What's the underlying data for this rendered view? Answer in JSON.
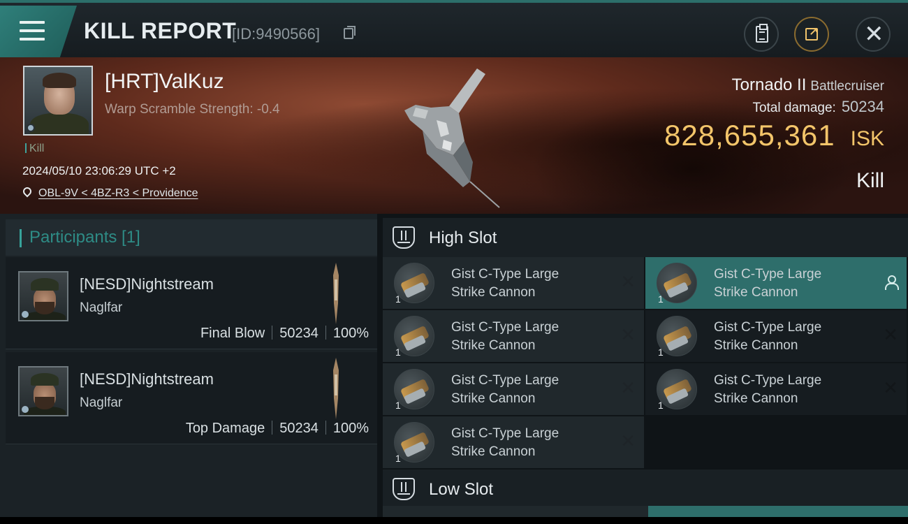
{
  "header": {
    "title": "KILL REPORT",
    "report_id": "[ID:9490566]",
    "icons": [
      "menu-icon",
      "copy-icon",
      "clipboard-icon",
      "share-icon",
      "close-icon"
    ]
  },
  "victim": {
    "name": "[HRT]ValKuz",
    "scramble": "Warp Scramble Strength: -0.4",
    "role": "Kill",
    "datetime": "2024/05/10 23:06:29 UTC +2",
    "location": "OBL-9V < 4BZ-R3 < Providence",
    "ship_name": "Tornado II",
    "ship_class": "Battlecruiser",
    "total_damage_label": "Total damage:",
    "total_damage": "50234",
    "isk_value": "828,655,361",
    "isk_unit": "ISK",
    "result": "Kill"
  },
  "participants": {
    "title": "Participants [1]",
    "rows": [
      {
        "name": "[NESD]Nightstream",
        "ship": "Naglfar",
        "tag": "Final Blow",
        "damage": "50234",
        "percent": "100%"
      },
      {
        "name": "[NESD]Nightstream",
        "ship": "Naglfar",
        "tag": "Top Damage",
        "damage": "50234",
        "percent": "100%"
      }
    ]
  },
  "fitting": {
    "high_slot_title": "High Slot",
    "low_slot_title": "Low Slot",
    "modules": [
      {
        "line1": "Gist C-Type Large",
        "line2": "Strike Cannon",
        "qty": "1"
      },
      {
        "line1": "Gist C-Type Large",
        "line2": "Strike Cannon",
        "qty": "1"
      },
      {
        "line1": "Gist C-Type Large",
        "line2": "Strike Cannon",
        "qty": "1"
      },
      {
        "line1": "Gist C-Type Large",
        "line2": "Strike Cannon",
        "qty": "1"
      },
      {
        "line1": "Gist C-Type Large",
        "line2": "Strike Cannon",
        "qty": "1"
      },
      {
        "line1": "Gist C-Type Large",
        "line2": "Strike Cannon",
        "qty": "1"
      },
      {
        "line1": "Gist C-Type Large",
        "line2": "Strike Cannon",
        "qty": "1"
      }
    ]
  },
  "colors": {
    "accent": "#2e6e6b",
    "isk": "#f3c56a",
    "hero": "#5e2a1c"
  }
}
